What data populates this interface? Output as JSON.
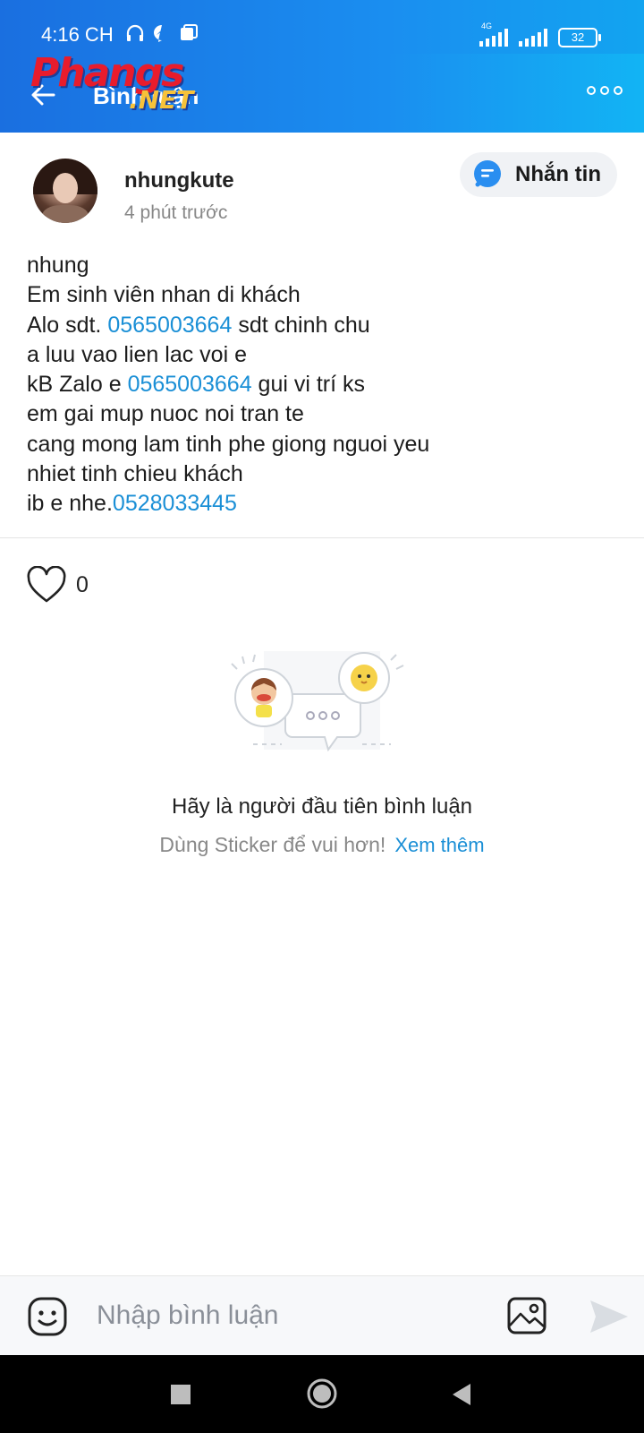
{
  "status_bar": {
    "time": "4:16 CH",
    "network": "4G",
    "battery": "32"
  },
  "header": {
    "title": "Bình luận",
    "watermark_top": "Phangs",
    "watermark_bottom": ".NET",
    "icons": {
      "back": "arrow-left-icon",
      "more": "more-dots-icon"
    }
  },
  "post": {
    "author": "nhungkute",
    "time_ago": "4 phút trước",
    "message_button": "Nhắn tin",
    "lines": {
      "l1": "nhung",
      "l2": "Em sinh viên nhan di khách",
      "l3a": "Alo sdt. ",
      "l3b": "0565003664",
      "l3c": " sdt chinh chu",
      "l4": "a luu vao lien lac voi e",
      "l5a": "kB Zalo e ",
      "l5b": "0565003664",
      "l5c": " gui vi trí ks",
      "l6": "em gai mup nuoc noi tran te",
      "l7": "cang mong lam tinh phe giong nguoi yeu",
      "l8": "nhiet tinh chieu khách",
      "l9a": "ib e nhe.",
      "l9b": "0528033445"
    },
    "likes": "0",
    "colors": {
      "link": "#1a8fd6",
      "text": "#1c1c1c"
    }
  },
  "empty_state": {
    "title": "Hãy là người đầu tiên bình luận",
    "subtitle": "Dùng Sticker để vui hơn!",
    "more_link": "Xem thêm"
  },
  "comment_bar": {
    "placeholder": "Nhập bình luận",
    "icons": {
      "emoji": "emoji-icon",
      "image": "image-icon",
      "send": "send-icon"
    }
  },
  "nav_bar": {
    "icons": {
      "recent": "square-icon",
      "home": "circle-icon",
      "back": "triangle-back-icon"
    }
  },
  "theme": {
    "accent": "#1a8ef0",
    "header_start": "#1a6fe0",
    "header_end": "#12b4f4"
  }
}
